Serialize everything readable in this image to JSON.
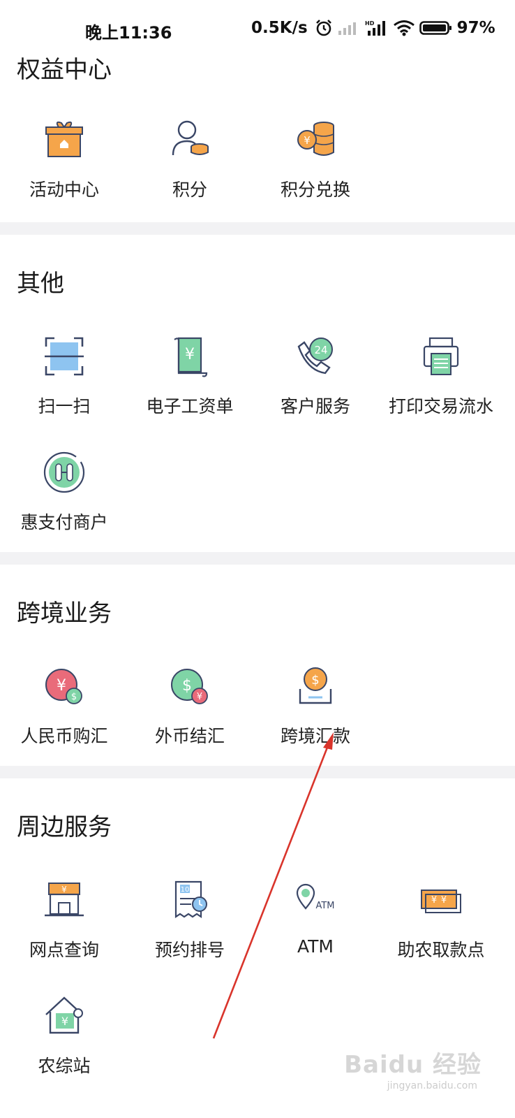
{
  "status_bar": {
    "time": "晚上11:36",
    "speed": "0.5K/s",
    "battery": "97%"
  },
  "sections": [
    {
      "title": "权益中心",
      "items": [
        {
          "label": "活动中心",
          "icon": "gift-icon"
        },
        {
          "label": "积分",
          "icon": "user-coins-icon"
        },
        {
          "label": "积分兑换",
          "icon": "coin-stack-icon"
        }
      ]
    },
    {
      "title": "其他",
      "items": [
        {
          "label": "扫一扫",
          "icon": "scan-icon"
        },
        {
          "label": "电子工资单",
          "icon": "payslip-icon"
        },
        {
          "label": "客户服务",
          "icon": "phone-24-icon"
        },
        {
          "label": "打印交易流水",
          "icon": "printer-icon"
        },
        {
          "label": "惠支付商户",
          "icon": "merchant-pay-icon"
        }
      ]
    },
    {
      "title": "跨境业务",
      "items": [
        {
          "label": "人民币购汇",
          "icon": "rmb-exchange-icon"
        },
        {
          "label": "外币结汇",
          "icon": "foreign-exchange-icon"
        },
        {
          "label": "跨境汇款",
          "icon": "remittance-icon"
        }
      ]
    },
    {
      "title": "周边服务",
      "items": [
        {
          "label": "网点查询",
          "icon": "branch-icon"
        },
        {
          "label": "预约排号",
          "icon": "queue-ticket-icon"
        },
        {
          "label": "ATM",
          "icon": "atm-location-icon"
        },
        {
          "label": "助农取款点",
          "icon": "cash-point-icon"
        },
        {
          "label": "农综站",
          "icon": "house-icon"
        }
      ]
    }
  ],
  "icon_text": {
    "yen": "¥",
    "dollar": "$",
    "phone_hours": "24",
    "ticket_no": "10",
    "atm": "ATM"
  },
  "colors": {
    "orange": "#f5a54a",
    "blue": "#8ec4f0",
    "green": "#7fd4a6",
    "red": "#e96b7a",
    "outline": "#3a4666",
    "arrow": "#d9342b"
  },
  "watermark": {
    "main": "Baidu 经验",
    "sub": "jingyan.baidu.com"
  }
}
